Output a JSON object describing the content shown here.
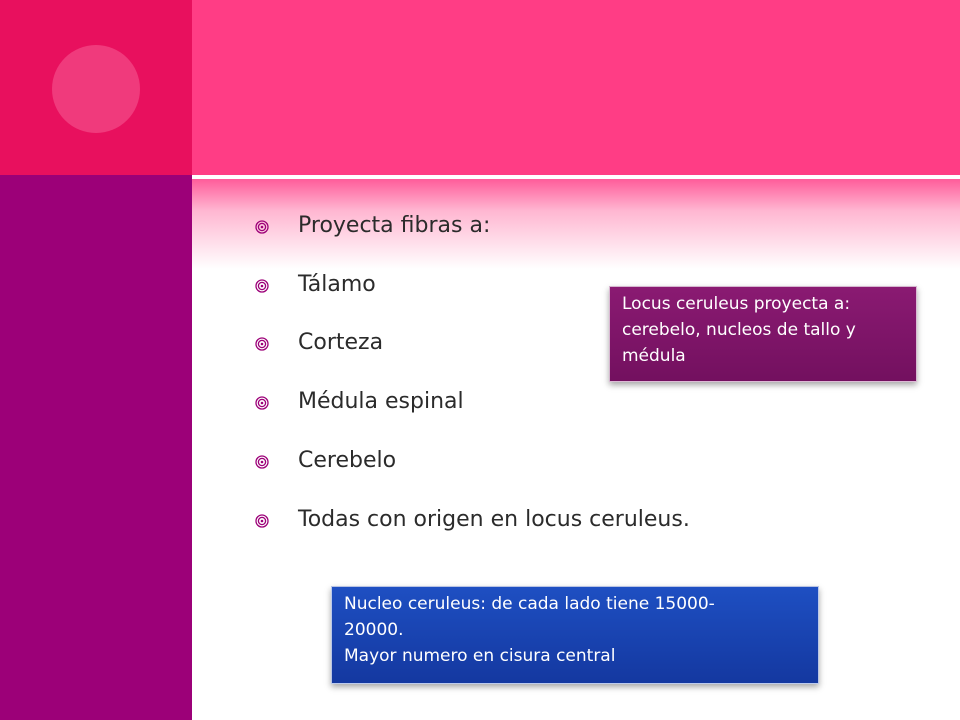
{
  "slide": {
    "colors": {
      "left_top": "#e8105e",
      "left_bottom": "#9c0078",
      "header": "#ff3d85",
      "circle": "#f03a7c",
      "callout_purple": "#7a1566",
      "callout_blue": "#1a45b4"
    },
    "bullet_icon": "circle-bullet-icon",
    "bullets": [
      "Proyecta fibras  a:",
      "Tálamo",
      "Corteza",
      "Médula espinal",
      "Cerebelo",
      "Todas con origen en locus ceruleus."
    ],
    "callout_1": {
      "lines": [
        "Locus ceruleus proyecta a:",
        "cerebelo, nucleos de tallo y",
        "médula"
      ]
    },
    "callout_2": {
      "lines": [
        "Nucleo ceruleus: de cada lado tiene 15000-",
        "20000.",
        "Mayor numero en cisura central"
      ]
    }
  }
}
